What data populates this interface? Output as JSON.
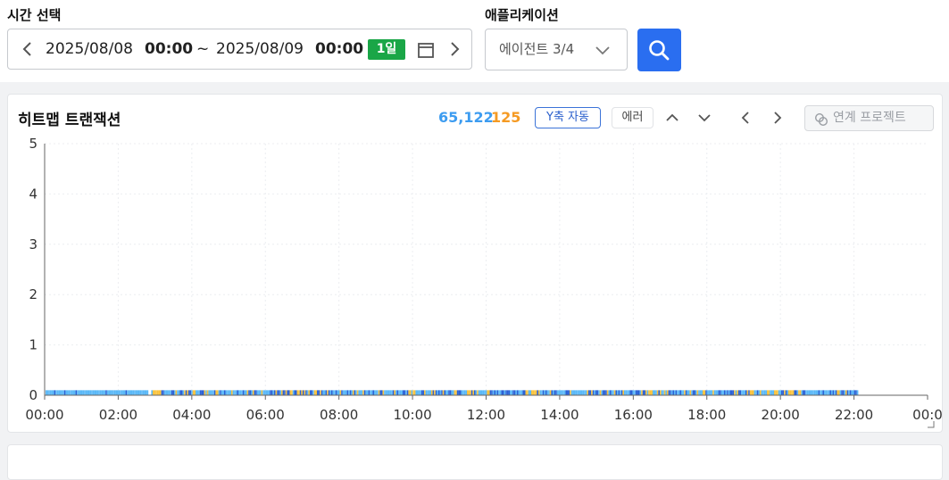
{
  "filters": {
    "time_label": "시간 선택",
    "start_date": "2025/08/08",
    "start_time": "00:00",
    "separator": "~",
    "end_date": "2025/08/09",
    "end_time": "00:00",
    "range_badge": "1일",
    "app_label": "애플리케이션",
    "app_value": "에이전트 3/4"
  },
  "panel": {
    "title": "히트맵 트랜잭션",
    "count_normal": "65,122",
    "count_error": "125",
    "y_axis_button": "Y축 자동",
    "error_button": "에러",
    "link_button": "연계 프로젝트"
  },
  "colors": {
    "accent": "#2a6ef0",
    "badge_green": "#1aa647",
    "normal_light": "#5ab8f7",
    "normal_dark": "#2b62d6",
    "error_orange": "#f9c23c"
  },
  "chart_data": {
    "type": "heatmap",
    "title": "",
    "xlabel": "",
    "ylabel": "",
    "y_ticks": [
      "5",
      "4",
      "3",
      "2",
      "1",
      "0"
    ],
    "ylim": [
      0,
      5
    ],
    "x_ticks": [
      "00:00",
      "02:00",
      "04:00",
      "06:00",
      "08:00",
      "10:00",
      "12:00",
      "14:00",
      "16:00",
      "18:00",
      "20:00",
      "22:00",
      "00:0"
    ],
    "xlim_hours": [
      0,
      24
    ],
    "data_extent_hours": [
      0,
      22.1
    ],
    "gap_hours": [
      2.8,
      2.87
    ],
    "y_band": [
      0,
      0.1
    ],
    "grid": true
  }
}
